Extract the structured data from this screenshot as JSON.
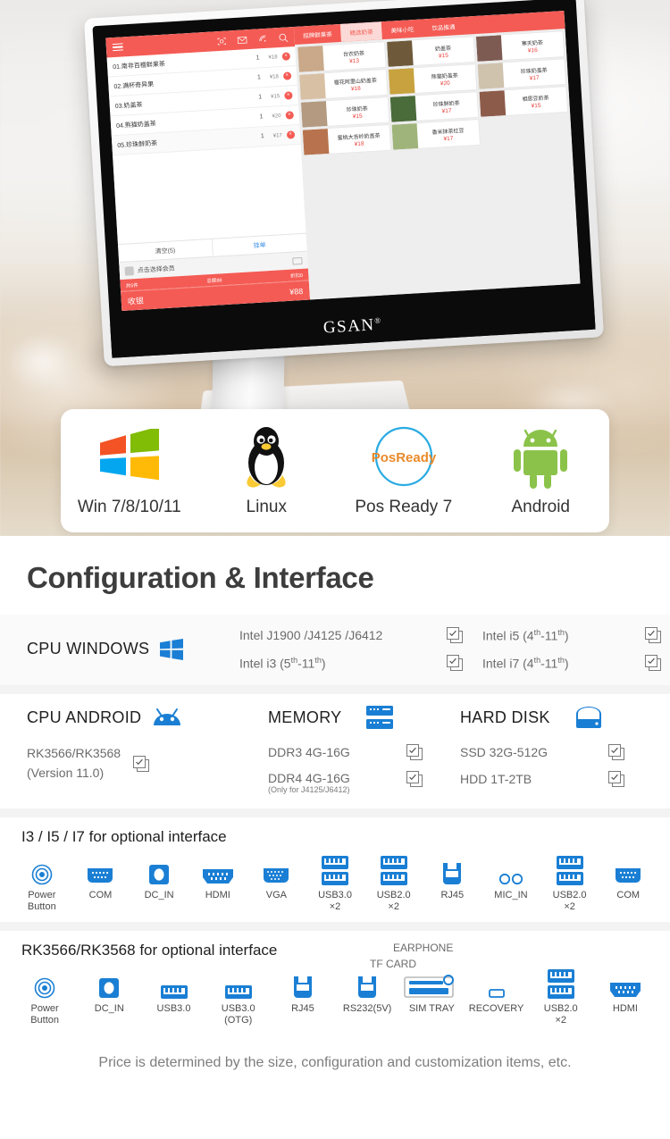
{
  "hero": {
    "brand": "GSAN",
    "brand_mark": "®",
    "pos": {
      "toolbar_icons": [
        "hamburger-icon",
        "scan-icon",
        "mail-icon",
        "wifi-icon",
        "search-icon"
      ],
      "order_items": [
        {
          "name": "01.南非百檀鲜果茶",
          "qty": "1",
          "price": "¥18"
        },
        {
          "name": "02.满杯奇异果",
          "qty": "1",
          "price": "¥18"
        },
        {
          "name": "03.奶盖茶",
          "qty": "1",
          "price": "¥15"
        },
        {
          "name": "04.熊猫奶盖茶",
          "qty": "1",
          "price": "¥20"
        },
        {
          "name": "05.珍珠鲜奶茶",
          "qty": "1",
          "price": "¥17"
        }
      ],
      "clear_label": "清空(5)",
      "hold_label": "挂单",
      "member_placeholder": "点击选择会员",
      "summary_count": "共5件",
      "summary_total": "总额88",
      "summary_discount": "折扣0",
      "checkout_label": "收银",
      "checkout_amount": "¥88",
      "tabs": [
        {
          "label": "招牌鲜果茶",
          "active": false
        },
        {
          "label": "精选奶茶",
          "active": true
        },
        {
          "label": "美味小吃",
          "active": false
        },
        {
          "label": "饮品推通",
          "active": false
        }
      ],
      "products": [
        {
          "name": "台农奶茶",
          "price": "¥13",
          "thumb": "#c9a98a"
        },
        {
          "name": "奶盖茶",
          "price": "¥15",
          "thumb": "#6e5a3a"
        },
        {
          "name": "寒天奶茶",
          "price": "¥16",
          "thumb": "#7d5b52"
        },
        {
          "name": "樱花阿里山奶盖茶",
          "price": "¥18",
          "thumb": "#d8c0a4"
        },
        {
          "name": "熊猫奶盖茶",
          "price": "¥20",
          "thumb": "#c7a23e"
        },
        {
          "name": "珍珠奶盖茶",
          "price": "¥17",
          "thumb": "#cfc3ae"
        },
        {
          "name": "珍珠奶茶",
          "price": "¥15",
          "thumb": "#b39a80"
        },
        {
          "name": "珍珠鲜奶茶",
          "price": "¥17",
          "thumb": "#4a6b3a"
        },
        {
          "name": "相思豆奶茶",
          "price": "¥15",
          "thumb": "#8d5b4a"
        },
        {
          "name": "蜜桃大吉岭奶盖茶",
          "price": "¥18",
          "thumb": "#b8734e"
        },
        {
          "name": "香米抹茶红豆",
          "price": "¥17",
          "thumb": "#9fb47a"
        }
      ]
    }
  },
  "os_band": {
    "items": [
      {
        "label": "Win 7/8/10/11",
        "icon": "windows-logo-icon"
      },
      {
        "label": "Linux",
        "icon": "linux-tux-icon"
      },
      {
        "label": "Pos Ready 7",
        "icon": "posready-logo-icon",
        "logo_text": "PosReady"
      },
      {
        "label": "Android",
        "icon": "android-robot-icon"
      }
    ]
  },
  "config": {
    "title": "Configuration & Interface",
    "cpu_windows": {
      "label": "CPU WINDOWS",
      "icon": "windows-logo-icon",
      "specs": [
        {
          "text": "Intel  J1900 /J4125 /J6412",
          "checked": true
        },
        {
          "text": "Intel  i5 (4",
          "sup1": "th",
          "dash": "-11",
          "sup2": "th",
          "tail": ")",
          "checked": true
        },
        {
          "text": "Intel  i3 (5",
          "sup1": "th",
          "dash": "-11",
          "sup2": "th",
          "tail": ")",
          "checked": true
        },
        {
          "text": "Intel  i7 (4",
          "sup1": "th",
          "dash": "-11",
          "sup2": "th",
          "tail": ")",
          "checked": true
        }
      ],
      "spec_left_top": "Intel  J1900 /J4125 /J6412",
      "spec_left_bottom_a": "Intel  i3 (5",
      "spec_left_bottom_b": "-11",
      "spec_left_bottom_c": ")",
      "spec_right_top_a": "Intel  i5 (4",
      "spec_right_top_b": "-11",
      "spec_right_top_c": ")",
      "spec_right_bottom_a": "Intel  i7 (4",
      "spec_right_bottom_b": "-11",
      "spec_right_bottom_c": ")",
      "sup_th": "th"
    },
    "cpu_android": {
      "label": "CPU ANDROID",
      "icon": "android-head-icon",
      "model_line1": "RK3566/RK3568",
      "model_line2": "(Version 11.0)",
      "checked": true
    },
    "memory": {
      "label": "MEMORY",
      "icon": "memory-module-icon",
      "options": [
        {
          "text": "DDR3 4G-16G",
          "note": "",
          "checked": true
        },
        {
          "text": "DDR4 4G-16G",
          "note": "(Only for J4125/J6412)",
          "checked": true
        }
      ]
    },
    "hard_disk": {
      "label": "HARD DISK",
      "icon": "hard-disk-icon",
      "options": [
        {
          "text": "SSD 32G-512G",
          "checked": true
        },
        {
          "text": "HDD 1T-2TB",
          "checked": true
        }
      ]
    },
    "iface_intel": {
      "title": "I3 / I5 / I7 for optional interface",
      "ports": [
        {
          "label": "Power\nButton",
          "icon": "power-button-icon",
          "qty": ""
        },
        {
          "label": "COM",
          "icon": "com-port-icon",
          "qty": ""
        },
        {
          "label": "DC_IN",
          "icon": "dc-in-icon",
          "qty": ""
        },
        {
          "label": "HDMI",
          "icon": "hdmi-port-icon",
          "qty": ""
        },
        {
          "label": "VGA",
          "icon": "vga-port-icon",
          "qty": ""
        },
        {
          "label": "USB3.0",
          "icon": "usb-double-icon",
          "qty": "×2"
        },
        {
          "label": "USB2.0",
          "icon": "usb-double-icon",
          "qty": "×2"
        },
        {
          "label": "RJ45",
          "icon": "rj45-port-icon",
          "qty": ""
        },
        {
          "label": "MIC_IN",
          "icon": "audio-jacks-icon",
          "qty": ""
        },
        {
          "label": "USB2.0",
          "icon": "usb-double-icon",
          "qty": "×2"
        },
        {
          "label": "COM",
          "icon": "com-port-icon",
          "qty": ""
        }
      ]
    },
    "iface_rk": {
      "title": "RK3566/RK3568 for optional interface",
      "overlay_label_1": "EARPHONE",
      "overlay_label_2": "TF CARD",
      "ports": [
        {
          "label": "Power\nButton",
          "icon": "power-button-icon",
          "qty": ""
        },
        {
          "label": "DC_IN",
          "icon": "dc-in-icon",
          "qty": ""
        },
        {
          "label": "USB3.0",
          "icon": "usb-single-icon",
          "qty": ""
        },
        {
          "label": "USB3.0\n(OTG)",
          "icon": "usb-single-icon",
          "qty": ""
        },
        {
          "label": "RJ45",
          "icon": "rj45-port-icon",
          "qty": ""
        },
        {
          "label": "RS232(5V)",
          "icon": "rj45-port-icon",
          "qty": ""
        },
        {
          "label": "SIM TRAY",
          "icon": "sim-tray-icon",
          "qty": ""
        },
        {
          "label": "RECOVERY",
          "icon": "recovery-hole-icon",
          "qty": ""
        },
        {
          "label": "USB2.0",
          "icon": "usb-double-icon",
          "qty": "×2"
        },
        {
          "label": "HDMI",
          "icon": "hdmi-port-icon",
          "qty": ""
        }
      ]
    },
    "footer_note": "Price is determined by the size, configuration and customization items, etc."
  },
  "colors": {
    "accent_blue": "#1a7fd4",
    "pos_red": "#f45b54",
    "title_gray": "#3d3d3d",
    "spec_gray": "#6b6b6b",
    "android_green": "#8bc34a",
    "posready_orange": "#e98a2b"
  }
}
